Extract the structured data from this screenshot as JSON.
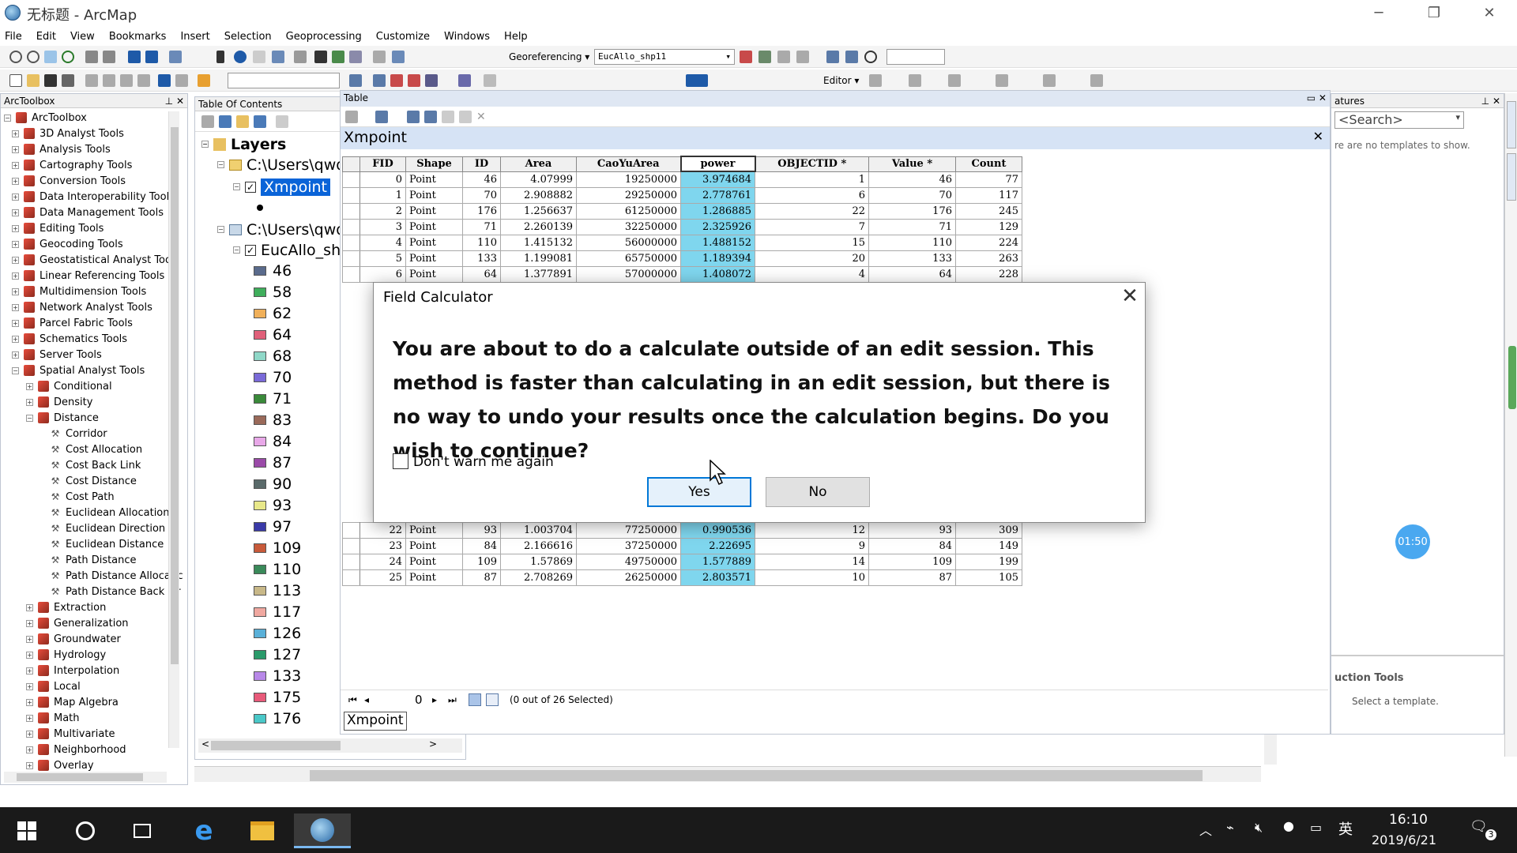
{
  "window": {
    "title": "无标题 - ArcMap"
  },
  "menu": [
    "File",
    "Edit",
    "View",
    "Bookmarks",
    "Insert",
    "Selection",
    "Geoprocessing",
    "Customize",
    "Windows",
    "Help"
  ],
  "toolbar": {
    "georef_label": "Georeferencing ▾",
    "georef_layer": "EucAllo_shp11",
    "editor_label": "Editor ▾"
  },
  "arctoolbox": {
    "title": "ArcToolbox",
    "root": "ArcToolbox",
    "toolboxes": [
      "3D Analyst Tools",
      "Analysis Tools",
      "Cartography Tools",
      "Conversion Tools",
      "Data Interoperability Tools",
      "Data Management Tools",
      "Editing Tools",
      "Geocoding Tools",
      "Geostatistical Analyst Tools",
      "Linear Referencing Tools",
      "Multidimension Tools",
      "Network Analyst Tools",
      "Parcel Fabric Tools",
      "Schematics Tools",
      "Server Tools",
      "Spatial Analyst Tools"
    ],
    "spatial_children_before": [
      "Conditional",
      "Density",
      "Distance"
    ],
    "distance_tools": [
      "Corridor",
      "Cost Allocation",
      "Cost Back Link",
      "Cost Distance",
      "Cost Path",
      "Euclidean Allocation",
      "Euclidean Direction",
      "Euclidean Distance",
      "Path Distance",
      "Path Distance Allocatic",
      "Path Distance Back Lir"
    ],
    "spatial_children_after": [
      "Extraction",
      "Generalization",
      "Groundwater",
      "Hydrology",
      "Interpolation",
      "Local",
      "Map Algebra",
      "Math",
      "Multivariate",
      "Neighborhood",
      "Overlay"
    ]
  },
  "toc": {
    "title": "Table Of Contents",
    "layers_label": "Layers",
    "path1": "C:\\Users\\qwq'",
    "layer1": "Xmpoint",
    "path2": "C:\\Users\\qwq'",
    "layer2": "EucAllo_shp",
    "legend": [
      {
        "label": "46",
        "color": "#5a6b8c"
      },
      {
        "label": "58",
        "color": "#3fae5c"
      },
      {
        "label": "62",
        "color": "#f0b05a"
      },
      {
        "label": "64",
        "color": "#e0607a"
      },
      {
        "label": "68",
        "color": "#8fd8c8"
      },
      {
        "label": "70",
        "color": "#7a6ad8"
      },
      {
        "label": "71",
        "color": "#3a8a3a"
      },
      {
        "label": "83",
        "color": "#9a6a5a"
      },
      {
        "label": "84",
        "color": "#e8a8e8"
      },
      {
        "label": "87",
        "color": "#9a4aa8"
      },
      {
        "label": "90",
        "color": "#5a6a6a"
      },
      {
        "label": "93",
        "color": "#e8e88a"
      },
      {
        "label": "97",
        "color": "#3a3aa8"
      },
      {
        "label": "109",
        "color": "#c85a3a"
      },
      {
        "label": "110",
        "color": "#3a8a5a"
      },
      {
        "label": "113",
        "color": "#c8b888"
      },
      {
        "label": "117",
        "color": "#f0a8a0"
      },
      {
        "label": "126",
        "color": "#5ab0d8"
      },
      {
        "label": "127",
        "color": "#2a9a6a"
      },
      {
        "label": "133",
        "color": "#b888e8"
      },
      {
        "label": "175",
        "color": "#e85a7a"
      },
      {
        "label": "176",
        "color": "#4ac8c8"
      }
    ]
  },
  "table": {
    "window_title": "Table",
    "name": "Xmpoint",
    "columns": [
      "FID",
      "Shape",
      "ID",
      "Area",
      "CaoYuArea",
      "power",
      "OBJECTID *",
      "Value *",
      "Count"
    ],
    "rows_top": [
      [
        "0",
        "Point",
        "46",
        "4.07999",
        "19250000",
        "3.974684",
        "1",
        "46",
        "77"
      ],
      [
        "1",
        "Point",
        "70",
        "2.908882",
        "29250000",
        "2.778761",
        "6",
        "70",
        "117"
      ],
      [
        "2",
        "Point",
        "176",
        "1.256637",
        "61250000",
        "1.286885",
        "22",
        "176",
        "245"
      ],
      [
        "3",
        "Point",
        "71",
        "2.260139",
        "32250000",
        "2.325926",
        "7",
        "71",
        "129"
      ],
      [
        "4",
        "Point",
        "110",
        "1.415132",
        "56000000",
        "1.488152",
        "15",
        "110",
        "224"
      ],
      [
        "5",
        "Point",
        "133",
        "1.199081",
        "65750000",
        "1.189394",
        "20",
        "133",
        "263"
      ],
      [
        "6",
        "Point",
        "64",
        "1.377891",
        "57000000",
        "1.408072",
        "4",
        "64",
        "228"
      ]
    ],
    "rows_bottom": [
      [
        "22",
        "Point",
        "93",
        "1.003704",
        "77250000",
        "0.990536",
        "12",
        "93",
        "309"
      ],
      [
        "23",
        "Point",
        "84",
        "2.166616",
        "37250000",
        "2.22695",
        "9",
        "84",
        "149"
      ],
      [
        "24",
        "Point",
        "109",
        "1.57869",
        "49750000",
        "1.577889",
        "14",
        "109",
        "199"
      ],
      [
        "25",
        "Point",
        "87",
        "2.708269",
        "26250000",
        "2.803571",
        "10",
        "87",
        "105"
      ]
    ],
    "record_number": "0",
    "selection_status": "(0 out of 26 Selected)",
    "tab_label": "Xmpoint"
  },
  "dialog": {
    "title": "Field Calculator",
    "message": "You are about to do a calculate outside of an edit session. This method is faster than calculating in an edit session, but there is no way to undo your results once the calculation begins. Do you wish to continue?",
    "checkbox_label": "Don't warn me again",
    "yes_label": "Yes",
    "no_label": "No"
  },
  "create_features": {
    "title": "atures",
    "search_placeholder": "<Search>",
    "no_templates": "re are no templates to show.",
    "construction_title": "uction Tools",
    "select_template": "Select a template."
  },
  "timer_badge": "01:50",
  "taskbar": {
    "time": "16:10",
    "date": "2019/6/21",
    "ime": "英",
    "notifications": "3"
  }
}
